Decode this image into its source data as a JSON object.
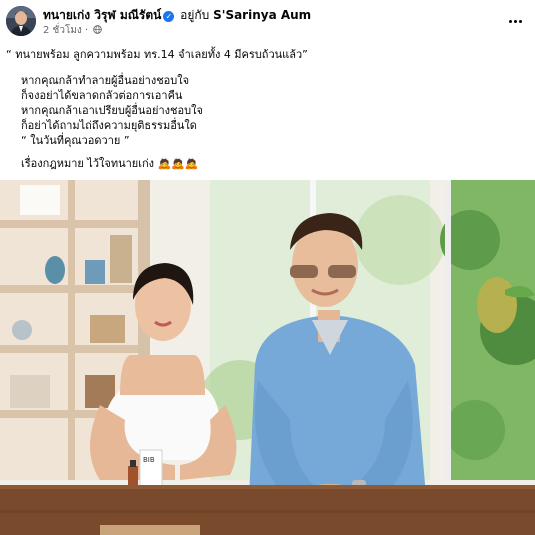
{
  "post": {
    "author": {
      "name": "ทนายเก่ง วิรุฬ มณีรัตน์",
      "verified_icon": "verified-badge-icon",
      "with_prefix": "อยู่กับ",
      "with_name": "S'Sarinya Aum"
    },
    "meta": {
      "time": "2 ชั่วโมง",
      "separator": "·",
      "privacy_icon": "globe-icon"
    },
    "more_icon": "more-horizontal-icon",
    "text": {
      "headline": "“ ทนายพร้อม ลูกความพร้อม ทร.14 จำเลยทั้ง 4 มีครบถ้วนแล้ว”",
      "lines": [
        "หากคุณกล้าทำลายผู้อื่นอย่างชอบใจ",
        "ก็จงอย่าได้ขลาดกลัวต่อการเอาคืน",
        "หากคุณกล้าเอาเปรียบผู้อื่นอย่างชอบใจ",
        "ก็อย่าได้ถามไถ่ถึงความยุติธรรมอื่นใด",
        "“ ในวันที่คุณวอดวาย ”"
      ],
      "footer": "เรื่องกฎหมาย ไว้ใจทนายเก่ง",
      "footer_emojis": "🙇🙇🙇"
    },
    "photo": {
      "product_label": "BIB",
      "colors": {
        "wall": "#f4f1ec",
        "shelf": "#ead9c6",
        "table": "#7a4a2c",
        "shirt": "#76a9d8",
        "dress": "#fbfbfb",
        "greenery": "#8fc46a"
      }
    }
  }
}
